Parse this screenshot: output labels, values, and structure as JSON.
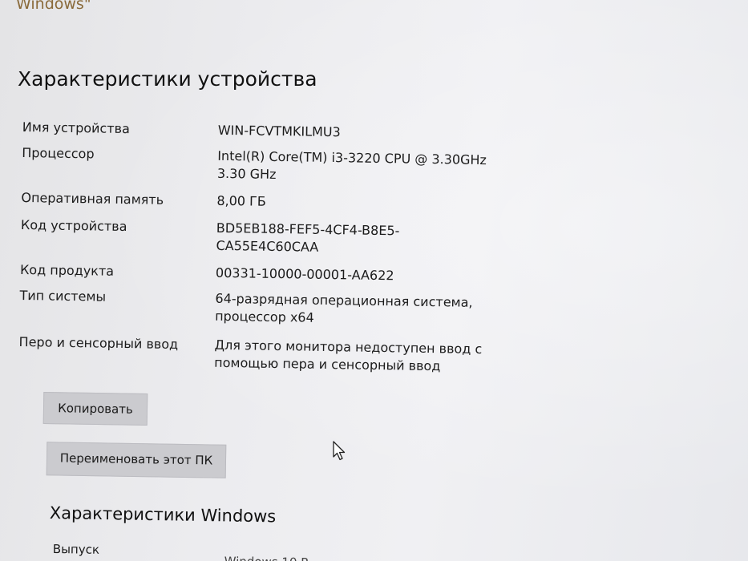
{
  "window": {
    "title": "Windows\""
  },
  "device_specs": {
    "title": "Характеристики устройства",
    "rows": [
      {
        "label": "Имя устройства",
        "value": "WIN-FCVTMKILMU3"
      },
      {
        "label": "Процессор",
        "value": "Intel(R) Core(TM) i3-3220 CPU @ 3.30GHz\n3.30 GHz"
      },
      {
        "label": "Оперативная память",
        "value": "8,00 ГБ"
      },
      {
        "label": "Код устройства",
        "value": "BD5EB188-FEF5-4CF4-B8E5-\nCA55E4C60CAA"
      },
      {
        "label": "Код продукта",
        "value": "00331-10000-00001-AA622"
      },
      {
        "label": "Тип системы",
        "value": "64-разрядная операционная система,\nпроцессор x64"
      },
      {
        "label": "Перо и сенсорный ввод",
        "value": "Для этого монитора недоступен ввод с\nпомощью пера и сенсорный ввод"
      }
    ],
    "copy_label": "Копировать",
    "rename_label": "Переименовать этот ПК"
  },
  "windows_specs": {
    "title": "Характеристики Windows",
    "edition_label": "Выпуск",
    "edition_value": "Windows 10 P"
  }
}
